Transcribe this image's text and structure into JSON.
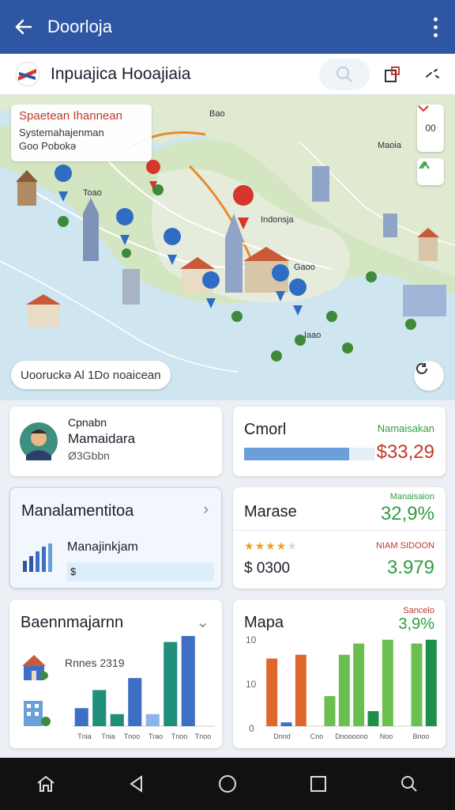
{
  "appbar": {
    "title": "Doorloja"
  },
  "header": {
    "title": "Inpuajica Hooajiaia"
  },
  "map": {
    "info_title": "Spaetean Ihannean",
    "info_line1": "Systemahajenman",
    "info_line2": "Goo Pobokə",
    "chip_label": "Uooruckə Al 1Do noaicean",
    "btn_top_label": "00",
    "labels": {
      "l1": "Indonsja",
      "l2": "Bao",
      "l3": "Maoia",
      "l4": "Toao",
      "l5": "Gaoo",
      "l6": "Iaao"
    }
  },
  "cards": {
    "profile": {
      "line1": "Cpnabn",
      "line2": "Mamaidara",
      "line3": "Ø3Gbbn"
    },
    "cmorl": {
      "title": "Cmorl",
      "tag": "Namaisakan",
      "value": "$33,29",
      "bar_fraction": 0.8
    },
    "manalamentitoa": {
      "title": "Manalamentitoa",
      "sub": "Manajinkjam",
      "currency": "$"
    },
    "marase": {
      "title": "Marase",
      "tag": "Manaisaion",
      "pct": "32,9%",
      "rating": 4,
      "tag2": "NIAM SIDOON",
      "amount": "$ 0300",
      "value2": "3.979"
    },
    "baen": {
      "title": "Baennmajarnn",
      "sub": "Rnnes 2319"
    },
    "mapa": {
      "title": "Mapa",
      "tag": "Sancelo",
      "pct": "3,9%",
      "y_top": "10",
      "y_mid": "10",
      "y_bot": "0"
    }
  },
  "chart_data": [
    {
      "type": "bar",
      "title": "Baennmajarnn",
      "subtitle": "Rnnes 2319",
      "categories": [
        "1",
        "2",
        "3",
        "4",
        "5",
        "6",
        "7",
        "8"
      ],
      "values": [
        3,
        6,
        2,
        8,
        2,
        14,
        15,
        0
      ],
      "colors": [
        "#3f6fc4",
        "#1e8f7a",
        "#1e8f7a",
        "#3f6fc4",
        "#8db4e8",
        "#1e8f7a",
        "#3f6fc4",
        "#3f6fc4"
      ],
      "tick_labels": [
        "Tnia",
        "Tnia",
        "Tnoo",
        "Trao",
        "Tnoo",
        "Tnoo"
      ]
    },
    {
      "type": "bar",
      "title": "Mapa",
      "categories": [
        "1",
        "2",
        "3",
        "4",
        "5",
        "6",
        "7",
        "8",
        "9",
        "10",
        "11",
        "12"
      ],
      "values": [
        9,
        0.5,
        9.5,
        0,
        4,
        9.5,
        11,
        2,
        11.5,
        0,
        11,
        11.5
      ],
      "colors": [
        "#e0672b",
        "#3f6fc4",
        "#e0672b",
        "#ffffff",
        "#6bbf4e",
        "#6bbf4e",
        "#6bbf4e",
        "#1e8f4a",
        "#6bbf4e",
        "#ffffff",
        "#6bbf4e",
        "#1e8f4a"
      ],
      "ylim": [
        0,
        12
      ],
      "tick_labels": [
        "Dnnd",
        "Cno",
        "Dnoooono",
        "Noo",
        "Bnoo"
      ]
    }
  ],
  "colors": {
    "primary": "#2f56a3",
    "accent_green": "#2e9e3f",
    "accent_red": "#c0392b"
  },
  "icons": {
    "back": "arrow-left-icon",
    "more": "more-vert-icon",
    "search": "search-icon",
    "share": "share-icon",
    "layers": "layers-icon"
  }
}
